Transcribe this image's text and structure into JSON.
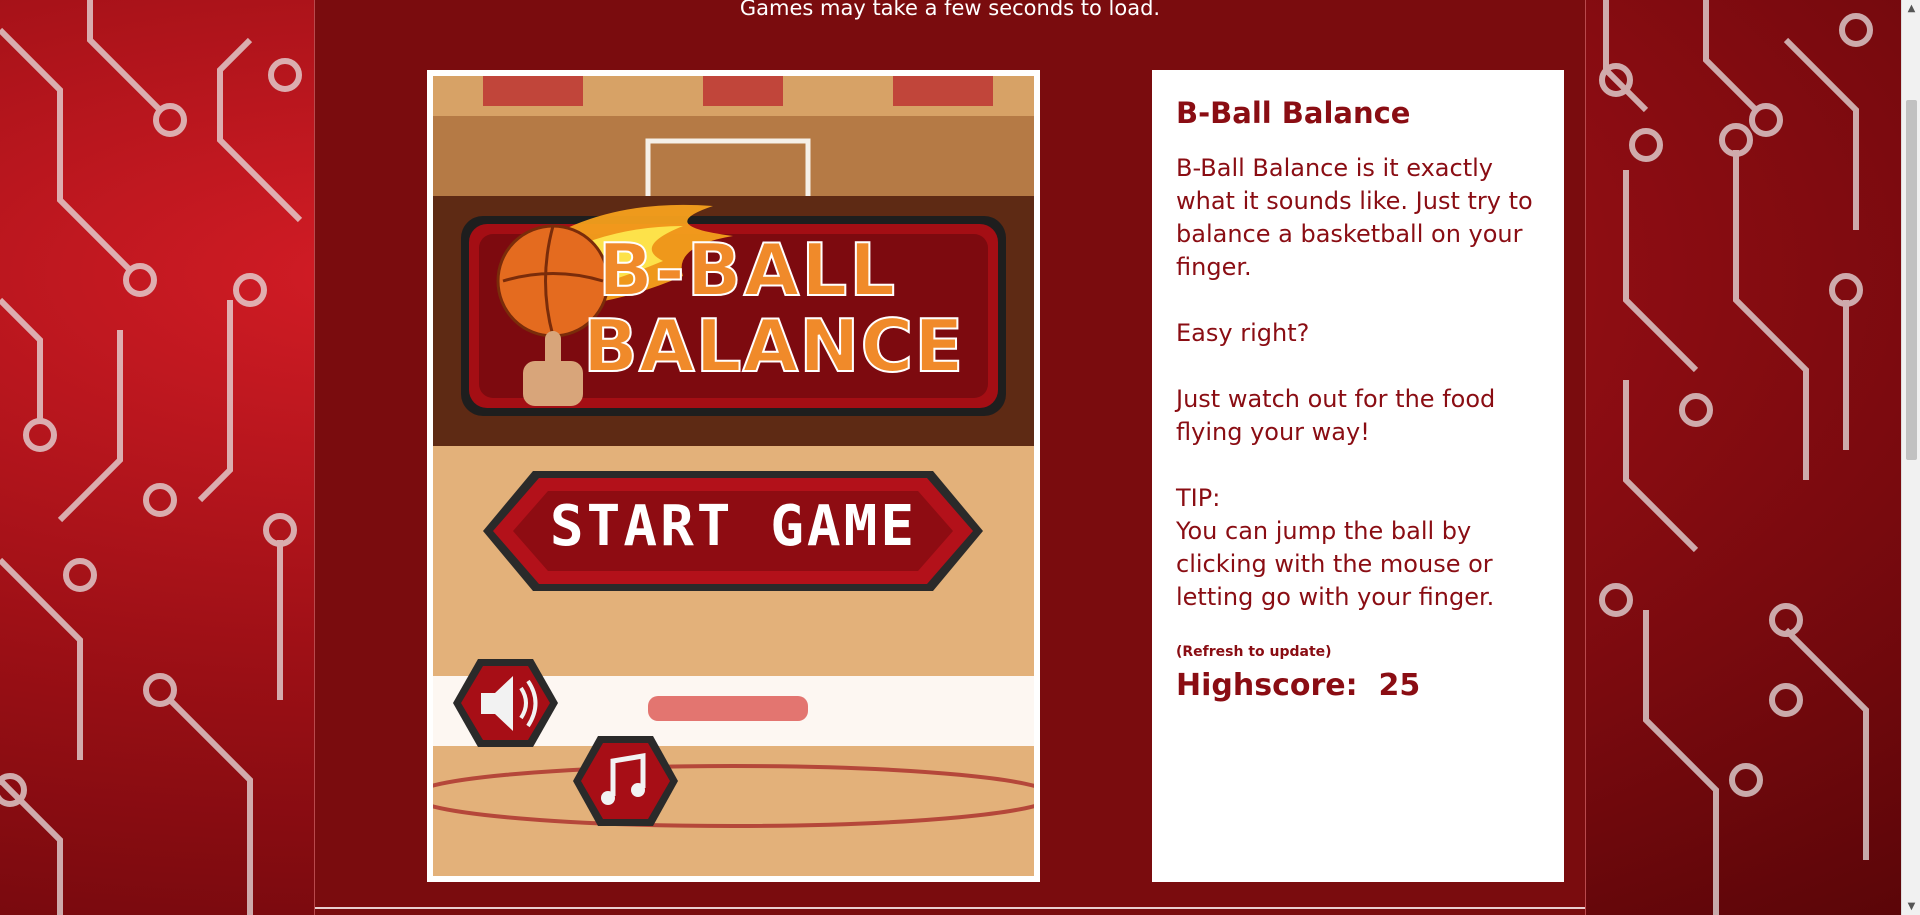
{
  "page": {
    "load_note": "Games may take a few seconds to load."
  },
  "game": {
    "title_line1": "B-BALL",
    "title_line2": "BALANCE",
    "start_label": "START GAME",
    "colors": {
      "accent": "#b30f18",
      "text_gold": "#f08a2a"
    }
  },
  "info": {
    "title": "B-Ball Balance",
    "description": "B-Ball Balance is it exactly what it sounds like. Just try to balance a basketball on your finger.",
    "easy": "Easy right?",
    "watch_out": "Just watch out for the food flying your way!",
    "tip_label": "TIP:",
    "tip_text": "You can jump the ball by clicking with the mouse or letting go with your finger.",
    "refresh_note": "(Refresh to update)",
    "highscore_label": "Highscore:",
    "highscore_value": "25"
  },
  "scrollbar": {
    "up_arrow": "▲",
    "down_arrow": "▼"
  }
}
